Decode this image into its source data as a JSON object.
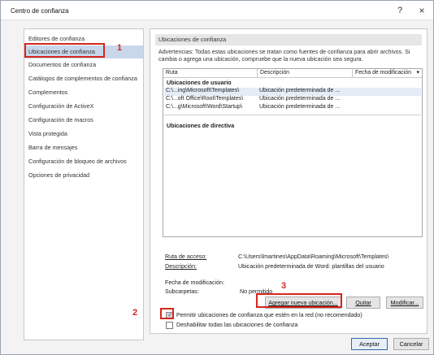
{
  "window": {
    "title": "Centro de confianza",
    "help_icon": "?",
    "close_icon": "×"
  },
  "sidebar": {
    "items": [
      {
        "label": "Editores de confianza"
      },
      {
        "label": "Ubicaciones de confianza",
        "selected": true
      },
      {
        "label": "Documentos de confianza"
      },
      {
        "label": "Catálogos de complementos de confianza"
      },
      {
        "label": "Complementos"
      },
      {
        "label": "Configuración de ActiveX"
      },
      {
        "label": "Configuración de macros"
      },
      {
        "label": "Vista protegida"
      },
      {
        "label": "Barra de mensajes"
      },
      {
        "label": "Configuración de bloqueo de archivos"
      },
      {
        "label": "Opciones de privacidad"
      }
    ]
  },
  "main": {
    "section_title": "Ubicaciones de confianza",
    "warning_line1": "Advertencias: Todas estas ubicaciones se tratan como fuentes de confianza para abrir archivos. Si",
    "warning_line2": "cambia o agrega una ubicación, compruebe que la nueva ubicación sea segura.",
    "table": {
      "columns": [
        "Ruta",
        "Descripción",
        "Fecha de modificación"
      ],
      "sort_icon": "▾",
      "user_group": "Ubicaciones de usuario",
      "rows": [
        {
          "path": "C:\\...ing\\Microsoft\\Templates\\",
          "description": "Ubicación predeterminada de ..."
        },
        {
          "path": "C:\\...oft Office\\Root\\Templates\\",
          "description": "Ubicación predeterminada de ..."
        },
        {
          "path": "C:\\...g\\Microsoft\\Word\\Startup\\",
          "description": "Ubicación predeterminada de ..."
        }
      ],
      "policy_group": "Ubicaciones de directiva"
    },
    "details": {
      "path_label": "Ruta de acceso:",
      "path_value": "C:\\Users\\lmartines\\AppData\\Roaming\\Microsoft\\Templates\\",
      "desc_label": "Descripción:",
      "desc_value": "Ubicación predeterminada de Word: plantillas del usuario",
      "date_label": "Fecha de modificación:",
      "subfolders_label": "Subcarpetas:",
      "subfolders_value": "No permitido"
    },
    "buttons": {
      "add": "Agregar nueva ubicación...",
      "remove": "Quitar",
      "modify": "Modificar..."
    },
    "options": {
      "allow_network": "Permitir ubicaciones de confianza que estén en la red (no recomendado)",
      "allow_network_checked": true,
      "disable_all": "Deshabilitar todas las ubicaciones de confianza",
      "disable_all_checked": false
    }
  },
  "footer": {
    "ok": "Aceptar",
    "cancel": "Cancelar"
  },
  "annotations": {
    "marker1": "1",
    "marker2": "2",
    "marker3": "3",
    "color": "#d7261e"
  }
}
